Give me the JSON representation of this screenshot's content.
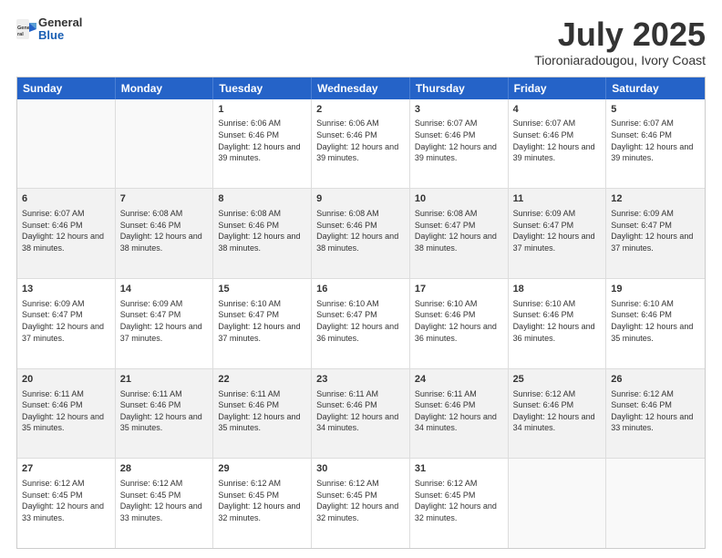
{
  "header": {
    "logo_general": "General",
    "logo_blue": "Blue",
    "month_title": "July 2025",
    "location": "Tioroniaradougou, Ivory Coast"
  },
  "calendar": {
    "days_of_week": [
      "Sunday",
      "Monday",
      "Tuesday",
      "Wednesday",
      "Thursday",
      "Friday",
      "Saturday"
    ],
    "rows": [
      [
        {
          "day": "",
          "empty": true
        },
        {
          "day": "",
          "empty": true
        },
        {
          "day": "1",
          "sunrise": "Sunrise: 6:06 AM",
          "sunset": "Sunset: 6:46 PM",
          "daylight": "Daylight: 12 hours and 39 minutes."
        },
        {
          "day": "2",
          "sunrise": "Sunrise: 6:06 AM",
          "sunset": "Sunset: 6:46 PM",
          "daylight": "Daylight: 12 hours and 39 minutes."
        },
        {
          "day": "3",
          "sunrise": "Sunrise: 6:07 AM",
          "sunset": "Sunset: 6:46 PM",
          "daylight": "Daylight: 12 hours and 39 minutes."
        },
        {
          "day": "4",
          "sunrise": "Sunrise: 6:07 AM",
          "sunset": "Sunset: 6:46 PM",
          "daylight": "Daylight: 12 hours and 39 minutes."
        },
        {
          "day": "5",
          "sunrise": "Sunrise: 6:07 AM",
          "sunset": "Sunset: 6:46 PM",
          "daylight": "Daylight: 12 hours and 39 minutes."
        }
      ],
      [
        {
          "day": "6",
          "sunrise": "Sunrise: 6:07 AM",
          "sunset": "Sunset: 6:46 PM",
          "daylight": "Daylight: 12 hours and 38 minutes."
        },
        {
          "day": "7",
          "sunrise": "Sunrise: 6:08 AM",
          "sunset": "Sunset: 6:46 PM",
          "daylight": "Daylight: 12 hours and 38 minutes."
        },
        {
          "day": "8",
          "sunrise": "Sunrise: 6:08 AM",
          "sunset": "Sunset: 6:46 PM",
          "daylight": "Daylight: 12 hours and 38 minutes."
        },
        {
          "day": "9",
          "sunrise": "Sunrise: 6:08 AM",
          "sunset": "Sunset: 6:46 PM",
          "daylight": "Daylight: 12 hours and 38 minutes."
        },
        {
          "day": "10",
          "sunrise": "Sunrise: 6:08 AM",
          "sunset": "Sunset: 6:47 PM",
          "daylight": "Daylight: 12 hours and 38 minutes."
        },
        {
          "day": "11",
          "sunrise": "Sunrise: 6:09 AM",
          "sunset": "Sunset: 6:47 PM",
          "daylight": "Daylight: 12 hours and 37 minutes."
        },
        {
          "day": "12",
          "sunrise": "Sunrise: 6:09 AM",
          "sunset": "Sunset: 6:47 PM",
          "daylight": "Daylight: 12 hours and 37 minutes."
        }
      ],
      [
        {
          "day": "13",
          "sunrise": "Sunrise: 6:09 AM",
          "sunset": "Sunset: 6:47 PM",
          "daylight": "Daylight: 12 hours and 37 minutes."
        },
        {
          "day": "14",
          "sunrise": "Sunrise: 6:09 AM",
          "sunset": "Sunset: 6:47 PM",
          "daylight": "Daylight: 12 hours and 37 minutes."
        },
        {
          "day": "15",
          "sunrise": "Sunrise: 6:10 AM",
          "sunset": "Sunset: 6:47 PM",
          "daylight": "Daylight: 12 hours and 37 minutes."
        },
        {
          "day": "16",
          "sunrise": "Sunrise: 6:10 AM",
          "sunset": "Sunset: 6:47 PM",
          "daylight": "Daylight: 12 hours and 36 minutes."
        },
        {
          "day": "17",
          "sunrise": "Sunrise: 6:10 AM",
          "sunset": "Sunset: 6:46 PM",
          "daylight": "Daylight: 12 hours and 36 minutes."
        },
        {
          "day": "18",
          "sunrise": "Sunrise: 6:10 AM",
          "sunset": "Sunset: 6:46 PM",
          "daylight": "Daylight: 12 hours and 36 minutes."
        },
        {
          "day": "19",
          "sunrise": "Sunrise: 6:10 AM",
          "sunset": "Sunset: 6:46 PM",
          "daylight": "Daylight: 12 hours and 35 minutes."
        }
      ],
      [
        {
          "day": "20",
          "sunrise": "Sunrise: 6:11 AM",
          "sunset": "Sunset: 6:46 PM",
          "daylight": "Daylight: 12 hours and 35 minutes."
        },
        {
          "day": "21",
          "sunrise": "Sunrise: 6:11 AM",
          "sunset": "Sunset: 6:46 PM",
          "daylight": "Daylight: 12 hours and 35 minutes."
        },
        {
          "day": "22",
          "sunrise": "Sunrise: 6:11 AM",
          "sunset": "Sunset: 6:46 PM",
          "daylight": "Daylight: 12 hours and 35 minutes."
        },
        {
          "day": "23",
          "sunrise": "Sunrise: 6:11 AM",
          "sunset": "Sunset: 6:46 PM",
          "daylight": "Daylight: 12 hours and 34 minutes."
        },
        {
          "day": "24",
          "sunrise": "Sunrise: 6:11 AM",
          "sunset": "Sunset: 6:46 PM",
          "daylight": "Daylight: 12 hours and 34 minutes."
        },
        {
          "day": "25",
          "sunrise": "Sunrise: 6:12 AM",
          "sunset": "Sunset: 6:46 PM",
          "daylight": "Daylight: 12 hours and 34 minutes."
        },
        {
          "day": "26",
          "sunrise": "Sunrise: 6:12 AM",
          "sunset": "Sunset: 6:46 PM",
          "daylight": "Daylight: 12 hours and 33 minutes."
        }
      ],
      [
        {
          "day": "27",
          "sunrise": "Sunrise: 6:12 AM",
          "sunset": "Sunset: 6:45 PM",
          "daylight": "Daylight: 12 hours and 33 minutes."
        },
        {
          "day": "28",
          "sunrise": "Sunrise: 6:12 AM",
          "sunset": "Sunset: 6:45 PM",
          "daylight": "Daylight: 12 hours and 33 minutes."
        },
        {
          "day": "29",
          "sunrise": "Sunrise: 6:12 AM",
          "sunset": "Sunset: 6:45 PM",
          "daylight": "Daylight: 12 hours and 32 minutes."
        },
        {
          "day": "30",
          "sunrise": "Sunrise: 6:12 AM",
          "sunset": "Sunset: 6:45 PM",
          "daylight": "Daylight: 12 hours and 32 minutes."
        },
        {
          "day": "31",
          "sunrise": "Sunrise: 6:12 AM",
          "sunset": "Sunset: 6:45 PM",
          "daylight": "Daylight: 12 hours and 32 minutes."
        },
        {
          "day": "",
          "empty": true
        },
        {
          "day": "",
          "empty": true
        }
      ]
    ]
  }
}
